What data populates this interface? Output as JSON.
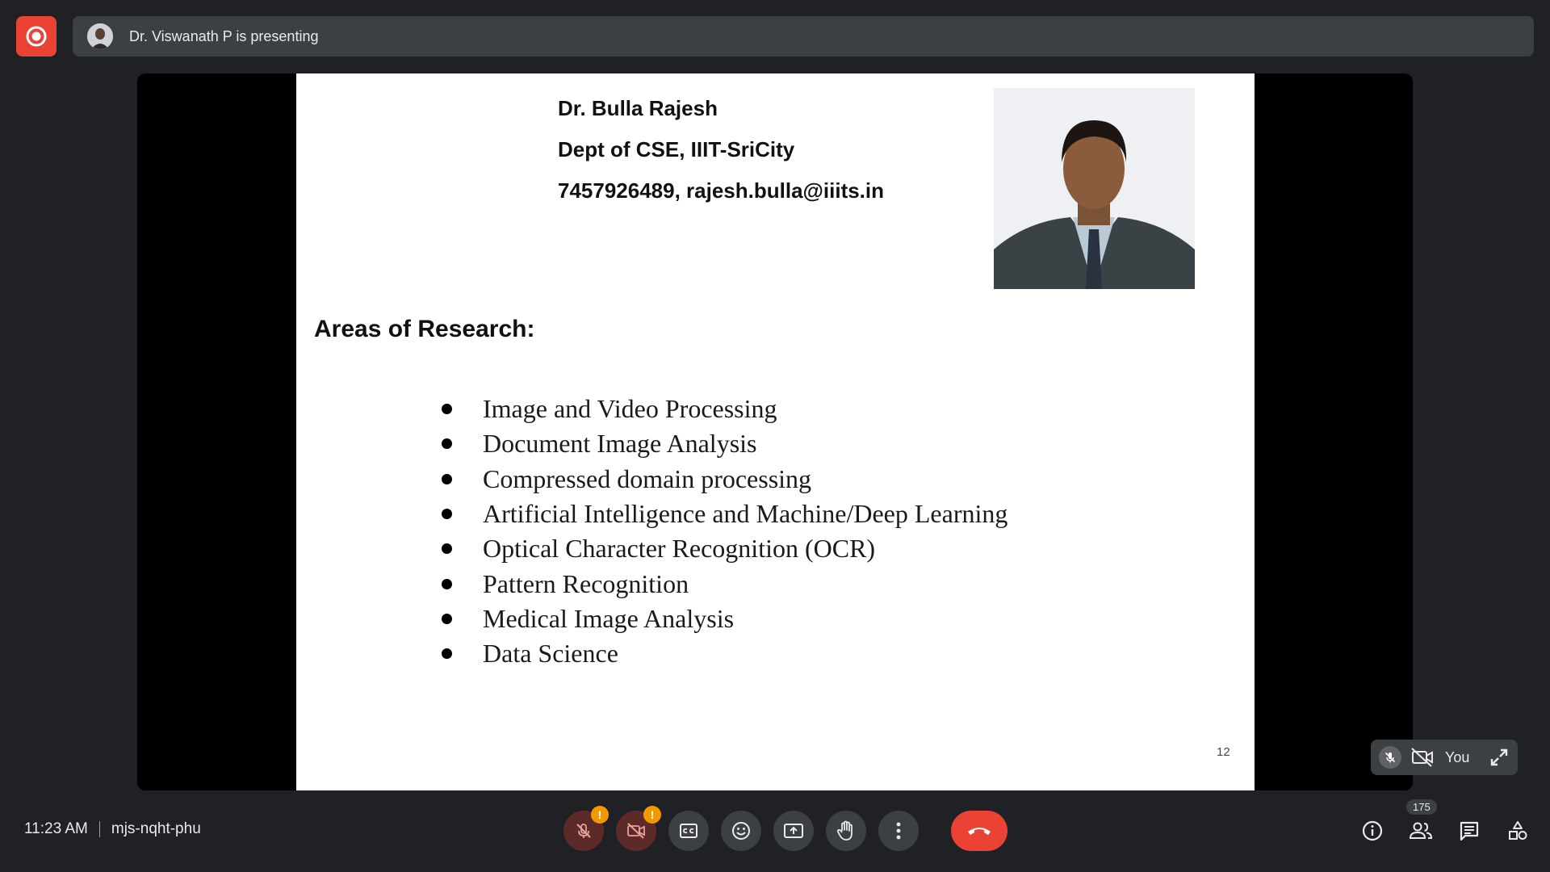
{
  "header": {
    "presenting_text": "Dr. Viswanath P is presenting"
  },
  "slide": {
    "contact_lines": [
      "Dr. Bulla Rajesh",
      "Dept of CSE, IIIT-SriCity",
      "7457926489, rajesh.bulla@iiits.in"
    ],
    "areas_heading": "Areas of Research:",
    "research_areas": [
      "Image and Video Processing",
      "Document Image Analysis",
      "Compressed domain processing",
      "Artificial Intelligence and Machine/Deep Learning",
      "Optical Character Recognition (OCR)",
      "Pattern Recognition",
      "Medical Image Analysis",
      "Data Science"
    ],
    "page_number": "12"
  },
  "self_view": {
    "label": "You"
  },
  "footer": {
    "time": "11:23 AM",
    "meeting_code": "mjs-nqht-phu",
    "participant_count": "175",
    "warning_glyph": "!"
  },
  "colors": {
    "background": "#202124",
    "bar": "#3c4043",
    "danger": "#ea4335",
    "warning": "#f29900"
  }
}
